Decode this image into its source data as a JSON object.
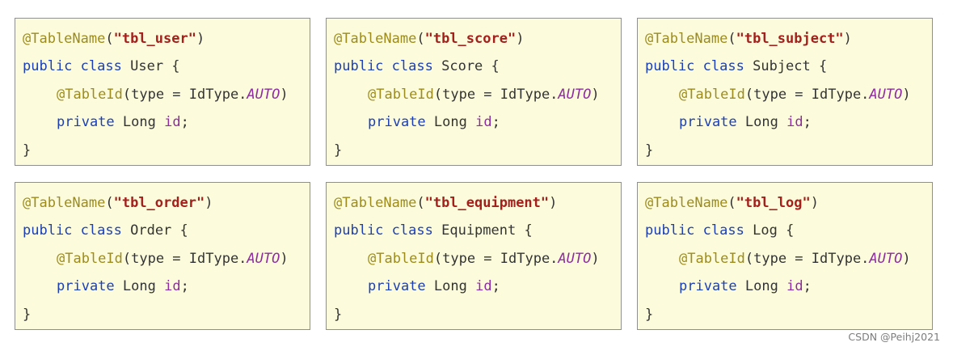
{
  "cards": [
    {
      "table": "\"tbl_user\"",
      "class_name": "User"
    },
    {
      "table": "\"tbl_score\"",
      "class_name": "Score"
    },
    {
      "table": "\"tbl_subject\"",
      "class_name": "Subject"
    },
    {
      "table": "\"tbl_order\"",
      "class_name": "Order"
    },
    {
      "table": "\"tbl_equipment\"",
      "class_name": "Equipment"
    },
    {
      "table": "\"tbl_log\"",
      "class_name": "Log"
    }
  ],
  "code": {
    "annotation": "@TableName",
    "open_paren": "(",
    "close_paren": ")",
    "public": "public",
    "class_kw": "class",
    "brace_open": " {",
    "id_annotation": "@TableId",
    "id_args_before": "(type = IdType.",
    "id_enum": "AUTO",
    "id_args_after": ")",
    "private": "private",
    "long_type": "Long",
    "field": "id",
    "semicolon": ";",
    "brace_close": "}"
  },
  "watermark": "CSDN @Peihj2021"
}
